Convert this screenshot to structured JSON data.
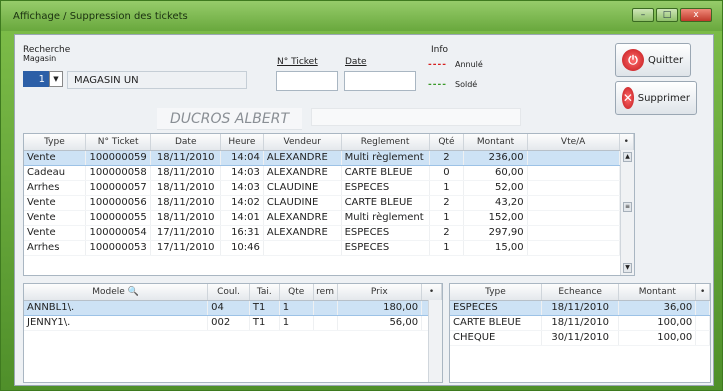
{
  "window": {
    "title": "Affichage / Suppression des tickets",
    "controls": [
      "–",
      "□",
      "x"
    ]
  },
  "search": {
    "label_recherche": "Recherche",
    "label_magasin": "Magasin",
    "magasin_num": "1",
    "magasin_name": "MAGASIN UN",
    "ticket_label": "N° Ticket",
    "date_label": "Date",
    "client_name": "DUCROS ALBERT"
  },
  "info": {
    "title": "Info",
    "annule": "Annulé",
    "solde": "Soldé",
    "annule_color": "#d62020",
    "solde_color": "#3a9a2a"
  },
  "buttons": {
    "quit": "Quitter",
    "delete": "Supprimer"
  },
  "tickets": {
    "headers": [
      "Type",
      "N° Ticket",
      "Date",
      "Heure",
      "Vendeur",
      "Reglement",
      "Qté",
      "Montant",
      "Vte/A"
    ],
    "rows": [
      [
        "Vente",
        "100000059",
        "18/11/2010",
        "14:04",
        "ALEXANDRE",
        "Multi règlement",
        "2",
        "236,00",
        ""
      ],
      [
        "Cadeau",
        "100000058",
        "18/11/2010",
        "14:03",
        "ALEXANDRE",
        "CARTE BLEUE",
        "0",
        "60,00",
        ""
      ],
      [
        "Arrhes",
        "100000057",
        "18/11/2010",
        "14:03",
        "CLAUDINE",
        "ESPECES",
        "1",
        "52,00",
        ""
      ],
      [
        "Vente",
        "100000056",
        "18/11/2010",
        "14:02",
        "CLAUDINE",
        "CARTE BLEUE",
        "2",
        "43,20",
        ""
      ],
      [
        "Vente",
        "100000055",
        "18/11/2010",
        "14:01",
        "ALEXANDRE",
        "Multi règlement",
        "1",
        "152,00",
        ""
      ],
      [
        "Vente",
        "100000054",
        "17/11/2010",
        "16:31",
        "ALEXANDRE",
        "ESPECES",
        "2",
        "297,90",
        ""
      ],
      [
        "Arrhes",
        "100000053",
        "17/11/2010",
        "10:46",
        "",
        "ESPECES",
        "1",
        "15,00",
        ""
      ]
    ]
  },
  "lines": {
    "headers": [
      "Modele",
      "Coul.",
      "Tai.",
      "Qte",
      "rem",
      "Prix"
    ],
    "rows": [
      [
        "ANNBL1\\.",
        "04",
        "T1",
        "1",
        "",
        "180,00"
      ],
      [
        "JENNY1\\.",
        "002",
        "T1",
        "1",
        "",
        "56,00"
      ]
    ]
  },
  "payments": {
    "headers": [
      "Type",
      "Echeance",
      "Montant"
    ],
    "rows": [
      [
        "ESPECES",
        "18/11/2010",
        "36,00"
      ],
      [
        "CARTE BLEUE",
        "18/11/2010",
        "100,00"
      ],
      [
        "CHEQUE",
        "30/11/2010",
        "100,00"
      ]
    ]
  }
}
